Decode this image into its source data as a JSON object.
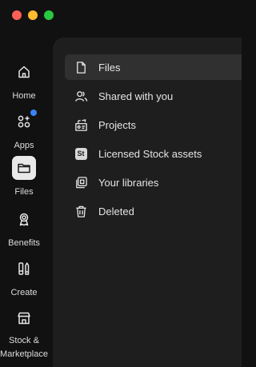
{
  "window": {
    "controls": [
      "close",
      "minimize",
      "zoom"
    ]
  },
  "rail": {
    "items": [
      {
        "label": "Home",
        "icon": "home-icon"
      },
      {
        "label": "Apps",
        "icon": "apps-icon",
        "has_notification": true
      },
      {
        "label": "Files",
        "icon": "folder-icon",
        "active": true
      },
      {
        "label": "Benefits",
        "icon": "ribbon-icon"
      },
      {
        "label": "Create",
        "icon": "create-icon"
      },
      {
        "label": "Stock &\nMarketplace",
        "icon": "storefront-icon"
      }
    ]
  },
  "files_menu": {
    "items": [
      {
        "label": "Files",
        "icon": "file-icon",
        "active": true
      },
      {
        "label": "Shared with you",
        "icon": "people-icon"
      },
      {
        "label": "Projects",
        "icon": "projects-icon"
      },
      {
        "label": "Licensed Stock assets",
        "icon": "stock-icon",
        "icon_text": "St"
      },
      {
        "label": "Your libraries",
        "icon": "libraries-icon"
      },
      {
        "label": "Deleted",
        "icon": "trash-icon"
      }
    ]
  },
  "colors": {
    "background": "#111111",
    "panel": "#1e1e1e",
    "active_item": "#303030",
    "notification": "#3b82f6"
  }
}
